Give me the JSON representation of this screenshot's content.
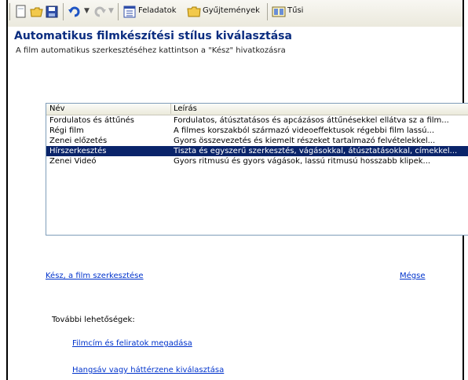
{
  "toolbar": {
    "tasks_label": "Feladatok",
    "collections_label": "Gyűjtemények",
    "third_label": "Tűsi"
  },
  "header": {
    "title": "Automatikus filmkészítési stílus kiválasztása",
    "subtitle": "A film automatikus szerkesztéséhez kattintson a \"Kész\" hivatkozásra"
  },
  "list": {
    "columns": [
      "Név",
      "Leírás"
    ],
    "rows": [
      {
        "name": "Fordulatos és áttűnés",
        "desc": "Fordulatos, átúsztatásos és apcázásos áttűnésekkel ellátva sz a film..."
      },
      {
        "name": "Régi film",
        "desc": "A filmes korszakból származó videoeffektusok régebbi film lassú..."
      },
      {
        "name": "Zenei előzetés",
        "desc": "Gyors összevezetés és kiemelt részeket tartalmazó felvételekkel..."
      },
      {
        "name": "Hírszerkesztés",
        "desc": "Tiszta és egyszerű szerkesztés, vágásokkal, átúsztatásokkal, címekkel..."
      },
      {
        "name": "Zenei Videó",
        "desc": "Gyors ritmusú és gyors vágások, lassú ritmusú hosszabb klipek..."
      }
    ],
    "selected_index": 3
  },
  "links": {
    "done": "Kész, a film szerkesztése",
    "cancel": "Mégse",
    "more_options_label": "További lehetőségek:",
    "enter_titles": "Filmcím és feliratok megadása",
    "select_music": "Hangsáv vagy háttérzene kiválasztása"
  }
}
